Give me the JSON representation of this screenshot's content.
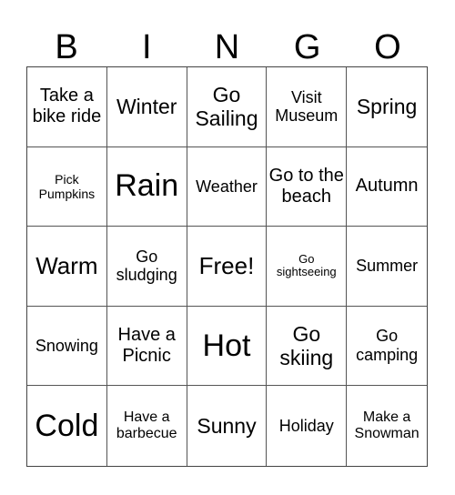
{
  "header": [
    "B",
    "I",
    "N",
    "G",
    "O"
  ],
  "cells": [
    {
      "text": "Take a bike ride",
      "size": "s-rg"
    },
    {
      "text": "Winter",
      "size": "s-md"
    },
    {
      "text": "Go Sailing",
      "size": "s-md"
    },
    {
      "text": "Visit Museum",
      "size": "s-sm"
    },
    {
      "text": "Spring",
      "size": "s-md"
    },
    {
      "text": "Pick Pumpkins",
      "size": "s-xxs"
    },
    {
      "text": "Rain",
      "size": "s-xl"
    },
    {
      "text": "Weather",
      "size": "s-sm"
    },
    {
      "text": "Go to the beach",
      "size": "s-rg"
    },
    {
      "text": "Autumn",
      "size": "s-rg"
    },
    {
      "text": "Warm",
      "size": "s-lg"
    },
    {
      "text": "Go sludging",
      "size": "s-sm"
    },
    {
      "text": "Free!",
      "size": "s-lg"
    },
    {
      "text": "Go sightseeing",
      "size": "s-tiny"
    },
    {
      "text": "Summer",
      "size": "s-sm"
    },
    {
      "text": "Snowing",
      "size": "s-sm"
    },
    {
      "text": "Have a Picnic",
      "size": "s-rg"
    },
    {
      "text": "Hot",
      "size": "s-xl"
    },
    {
      "text": "Go skiing",
      "size": "s-md"
    },
    {
      "text": "Go camping",
      "size": "s-sm"
    },
    {
      "text": "Cold",
      "size": "s-xl"
    },
    {
      "text": "Have a barbecue",
      "size": "s-xs"
    },
    {
      "text": "Sunny",
      "size": "s-md"
    },
    {
      "text": "Holiday",
      "size": "s-sm"
    },
    {
      "text": "Make a Snowman",
      "size": "s-xs"
    }
  ]
}
